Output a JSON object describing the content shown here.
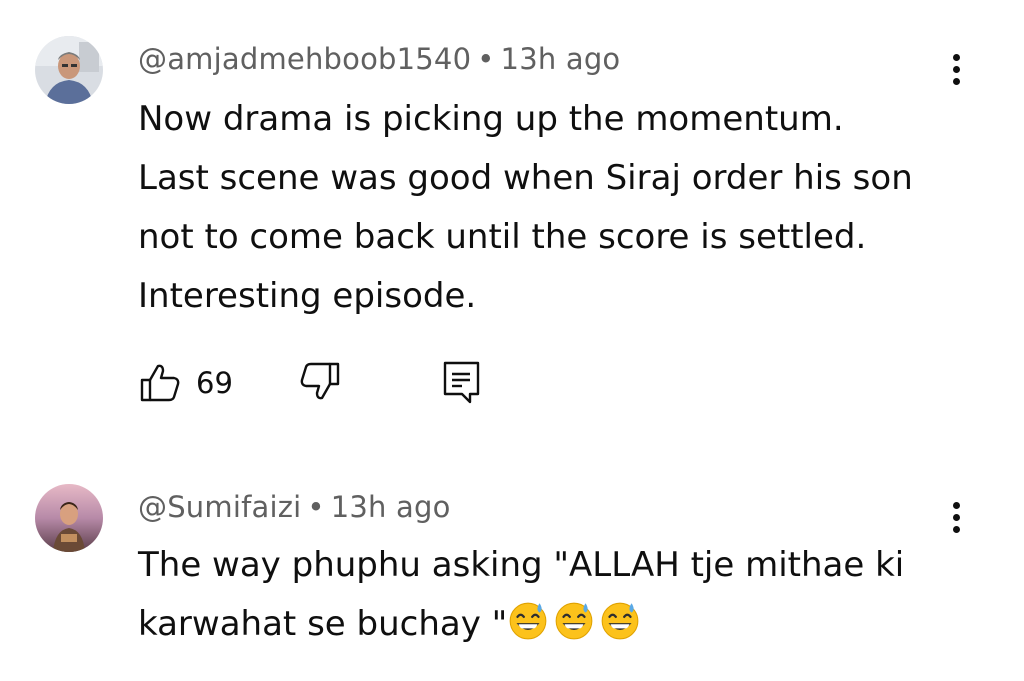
{
  "comments": [
    {
      "author": "@amjadmehboob1540",
      "separator": "•",
      "time": "13h ago",
      "lines": [
        "Now drama is picking up the momentum.",
        "Last scene was good when Siraj order his son",
        "not to come back until the score is settled.",
        "Interesting episode."
      ],
      "like_count": "69",
      "icons": {
        "like": "thumbs-up-icon",
        "dislike": "thumbs-down-icon",
        "reply": "reply-icon",
        "menu": "more-vertical-icon"
      }
    },
    {
      "author": "@Sumifaizi",
      "separator": "•",
      "time": "13h ago",
      "lines": [
        "The way phuphu asking \"ALLAH tje mithae ki",
        "karwahat se buchay \""
      ],
      "emoji": "grinning-face-with-sweat-emoji",
      "emoji_count": 3,
      "icons": {
        "menu": "more-vertical-icon"
      }
    }
  ],
  "colors": {
    "text": "#0f0f0f",
    "meta": "#606060",
    "background": "#ffffff",
    "emoji_face": "#fcc21b"
  }
}
